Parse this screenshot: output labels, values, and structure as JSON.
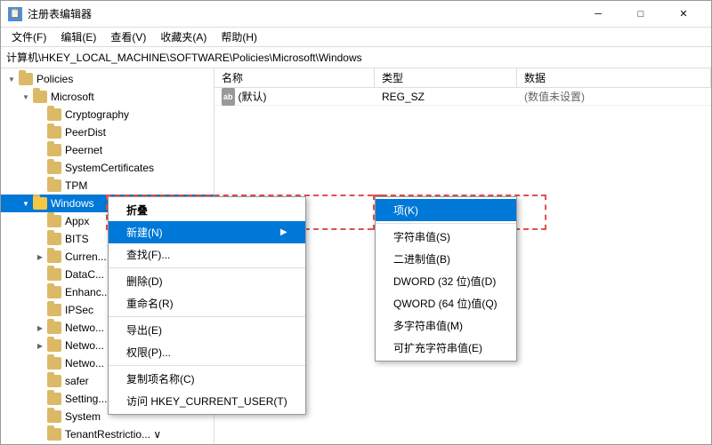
{
  "window": {
    "title": "注册表编辑器",
    "icon": "📋"
  },
  "titlebar": {
    "buttons": {
      "minimize": "─",
      "maximize": "□",
      "close": "✕"
    }
  },
  "menubar": {
    "items": [
      "文件(F)",
      "编辑(E)",
      "查看(V)",
      "收藏夹(A)",
      "帮助(H)"
    ]
  },
  "addressbar": {
    "path": "计算机\\HKEY_LOCAL_MACHINE\\SOFTWARE\\Policies\\Microsoft\\Windows"
  },
  "tree": {
    "items": [
      {
        "id": "policies",
        "label": "Policies",
        "indent": 1,
        "expanded": true,
        "hasChildren": true
      },
      {
        "id": "microsoft",
        "label": "Microsoft",
        "indent": 2,
        "expanded": true,
        "hasChildren": true
      },
      {
        "id": "cryptography",
        "label": "Cryptography",
        "indent": 3,
        "expanded": false,
        "hasChildren": false
      },
      {
        "id": "peerdist",
        "label": "PeerDist",
        "indent": 3,
        "expanded": false,
        "hasChildren": false
      },
      {
        "id": "peernet",
        "label": "Peernet",
        "indent": 3,
        "expanded": false,
        "hasChildren": false
      },
      {
        "id": "systemcerts",
        "label": "SystemCertificates",
        "indent": 3,
        "expanded": false,
        "hasChildren": false
      },
      {
        "id": "tpm",
        "label": "TPM",
        "indent": 3,
        "expanded": false,
        "hasChildren": false
      },
      {
        "id": "windows",
        "label": "Windows",
        "indent": 3,
        "expanded": true,
        "hasChildren": true,
        "selected": true
      },
      {
        "id": "appx",
        "label": "Appx",
        "indent": 4,
        "expanded": false,
        "hasChildren": false
      },
      {
        "id": "bits",
        "label": "BITS",
        "indent": 4,
        "expanded": false,
        "hasChildren": false
      },
      {
        "id": "current",
        "label": "Curren...",
        "indent": 4,
        "expanded": false,
        "hasChildren": true
      },
      {
        "id": "datac",
        "label": "DataC...",
        "indent": 4,
        "expanded": false,
        "hasChildren": false
      },
      {
        "id": "enhance",
        "label": "Enhanc...",
        "indent": 4,
        "expanded": false,
        "hasChildren": false
      },
      {
        "id": "ipsec",
        "label": "IPSec",
        "indent": 4,
        "expanded": false,
        "hasChildren": false
      },
      {
        "id": "netwo1",
        "label": "Netwo...",
        "indent": 4,
        "expanded": false,
        "hasChildren": true
      },
      {
        "id": "netwo2",
        "label": "Netwo...",
        "indent": 4,
        "expanded": false,
        "hasChildren": true
      },
      {
        "id": "netwo3",
        "label": "Netwo...",
        "indent": 4,
        "expanded": false,
        "hasChildren": false
      },
      {
        "id": "safer",
        "label": "safer",
        "indent": 4,
        "expanded": false,
        "hasChildren": false
      },
      {
        "id": "setting",
        "label": "Setting...",
        "indent": 4,
        "expanded": false,
        "hasChildren": false
      },
      {
        "id": "system",
        "label": "System",
        "indent": 4,
        "expanded": false,
        "hasChildren": false
      },
      {
        "id": "tenantrestriction",
        "label": "TenantRestrictio...",
        "indent": 4,
        "expanded": false,
        "hasChildren": false
      }
    ]
  },
  "rightpanel": {
    "headers": [
      "名称",
      "类型",
      "数据"
    ],
    "rows": [
      {
        "name": "(默认)",
        "namePrefix": "ab",
        "type": "REG_SZ",
        "data": "(数值未设置)"
      }
    ]
  },
  "contextmenu": {
    "items": [
      {
        "id": "collapse",
        "label": "折叠",
        "bold": false,
        "separator": false,
        "submenu": false
      },
      {
        "id": "new",
        "label": "新建(N)",
        "bold": false,
        "separator": false,
        "submenu": true,
        "highlighted": true
      },
      {
        "id": "find",
        "label": "查找(F)...",
        "bold": false,
        "separator": false,
        "submenu": false
      },
      {
        "id": "separator1",
        "type": "separator"
      },
      {
        "id": "delete",
        "label": "删除(D)",
        "bold": false,
        "separator": false,
        "submenu": false
      },
      {
        "id": "rename",
        "label": "重命名(R)",
        "bold": false,
        "separator": false,
        "submenu": false
      },
      {
        "id": "separator2",
        "type": "separator"
      },
      {
        "id": "export",
        "label": "导出(E)",
        "bold": false,
        "separator": false,
        "submenu": false
      },
      {
        "id": "permissions",
        "label": "权限(P)...",
        "bold": false,
        "separator": false,
        "submenu": false
      },
      {
        "id": "separator3",
        "type": "separator"
      },
      {
        "id": "copykey",
        "label": "复制项名称(C)",
        "bold": false,
        "separator": false,
        "submenu": false
      },
      {
        "id": "visituser",
        "label": "访问 HKEY_CURRENT_USER(T)",
        "bold": false,
        "separator": false,
        "submenu": false
      }
    ]
  },
  "submenu": {
    "items": [
      {
        "id": "key",
        "label": "项(K)",
        "highlighted": true
      },
      {
        "id": "separator1",
        "type": "separator"
      },
      {
        "id": "strval",
        "label": "字符串值(S)"
      },
      {
        "id": "binval",
        "label": "二进制值(B)"
      },
      {
        "id": "dword32",
        "label": "DWORD (32 位)值(D)"
      },
      {
        "id": "qword64",
        "label": "QWORD (64 位)值(Q)"
      },
      {
        "id": "multistr",
        "label": "多字符串值(M)"
      },
      {
        "id": "expandstr",
        "label": "可扩充字符串值(E)"
      }
    ]
  }
}
